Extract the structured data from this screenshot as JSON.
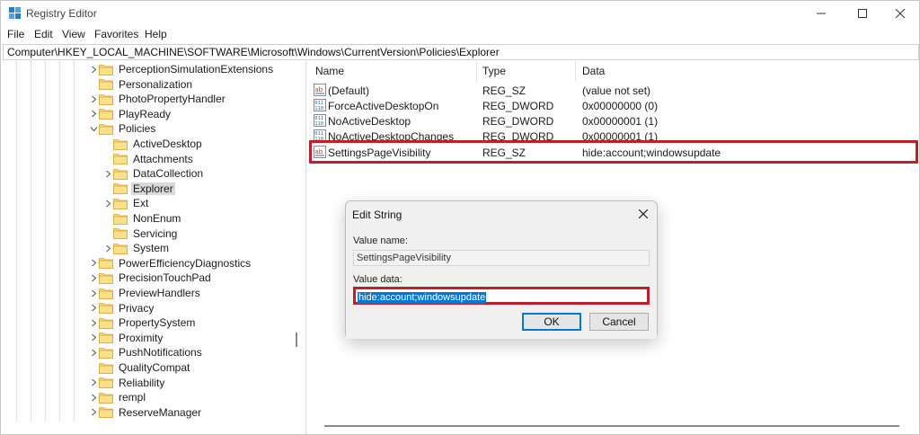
{
  "window": {
    "title": "Registry Editor",
    "minimize": "—",
    "maximize": "☐",
    "close": "✕"
  },
  "menu": [
    "File",
    "Edit",
    "View",
    "Favorites",
    "Help"
  ],
  "address": "Computer\\HKEY_LOCAL_MACHINE\\SOFTWARE\\Microsoft\\Windows\\CurrentVersion\\Policies\\Explorer",
  "tree": [
    {
      "label": "PerceptionSimulationExtensions",
      "chevron": "right"
    },
    {
      "label": "Personalization",
      "chevron": ""
    },
    {
      "label": "PhotoPropertyHandler",
      "chevron": "right"
    },
    {
      "label": "PlayReady",
      "chevron": "right"
    },
    {
      "label": "Policies",
      "chevron": "down"
    },
    {
      "label": "ActiveDesktop",
      "chevron": ""
    },
    {
      "label": "Attachments",
      "chevron": ""
    },
    {
      "label": "DataCollection",
      "chevron": "right"
    },
    {
      "label": "Explorer",
      "chevron": "",
      "selected": true
    },
    {
      "label": "Ext",
      "chevron": "right"
    },
    {
      "label": "NonEnum",
      "chevron": ""
    },
    {
      "label": "Servicing",
      "chevron": ""
    },
    {
      "label": "System",
      "chevron": "right"
    },
    {
      "label": "PowerEfficiencyDiagnostics",
      "chevron": "right"
    },
    {
      "label": "PrecisionTouchPad",
      "chevron": "right"
    },
    {
      "label": "PreviewHandlers",
      "chevron": "right"
    },
    {
      "label": "Privacy",
      "chevron": "right"
    },
    {
      "label": "PropertySystem",
      "chevron": "right"
    },
    {
      "label": "Proximity",
      "chevron": "right"
    },
    {
      "label": "PushNotifications",
      "chevron": "right"
    },
    {
      "label": "QualityCompat",
      "chevron": ""
    },
    {
      "label": "Reliability",
      "chevron": "right"
    },
    {
      "label": "rempl",
      "chevron": "right"
    },
    {
      "label": "ReserveManager",
      "chevron": "right"
    }
  ],
  "columns": {
    "name": "Name",
    "type": "Type",
    "data": "Data"
  },
  "values": [
    {
      "name": "(Default)",
      "type": "REG_SZ",
      "data": "(value not set)",
      "icon": "string-value-icon"
    },
    {
      "name": "ForceActiveDesktopOn",
      "type": "REG_DWORD",
      "data": "0x00000000 (0)",
      "icon": "dword-value-icon"
    },
    {
      "name": "NoActiveDesktop",
      "type": "REG_DWORD",
      "data": "0x00000001 (1)",
      "icon": "dword-value-icon"
    },
    {
      "name": "NoActiveDesktopChanges",
      "type": "REG_DWORD",
      "data": "0x00000001 (1)",
      "icon": "dword-value-icon"
    },
    {
      "name": "SettingsPageVisibility",
      "type": "REG_SZ",
      "data": "hide:account;windowsupdate",
      "icon": "string-value-icon",
      "highlighted": true
    }
  ],
  "dialog": {
    "title": "Edit String",
    "value_name_label": "Value name:",
    "value_name": "SettingsPageVisibility",
    "value_data_label": "Value data:",
    "value_data": "hide:account;windowsupdate",
    "ok": "OK",
    "cancel": "Cancel"
  },
  "colors": {
    "highlight_border": "#c11e2c",
    "selection": "#0078d7",
    "folder": "#f8d775"
  }
}
